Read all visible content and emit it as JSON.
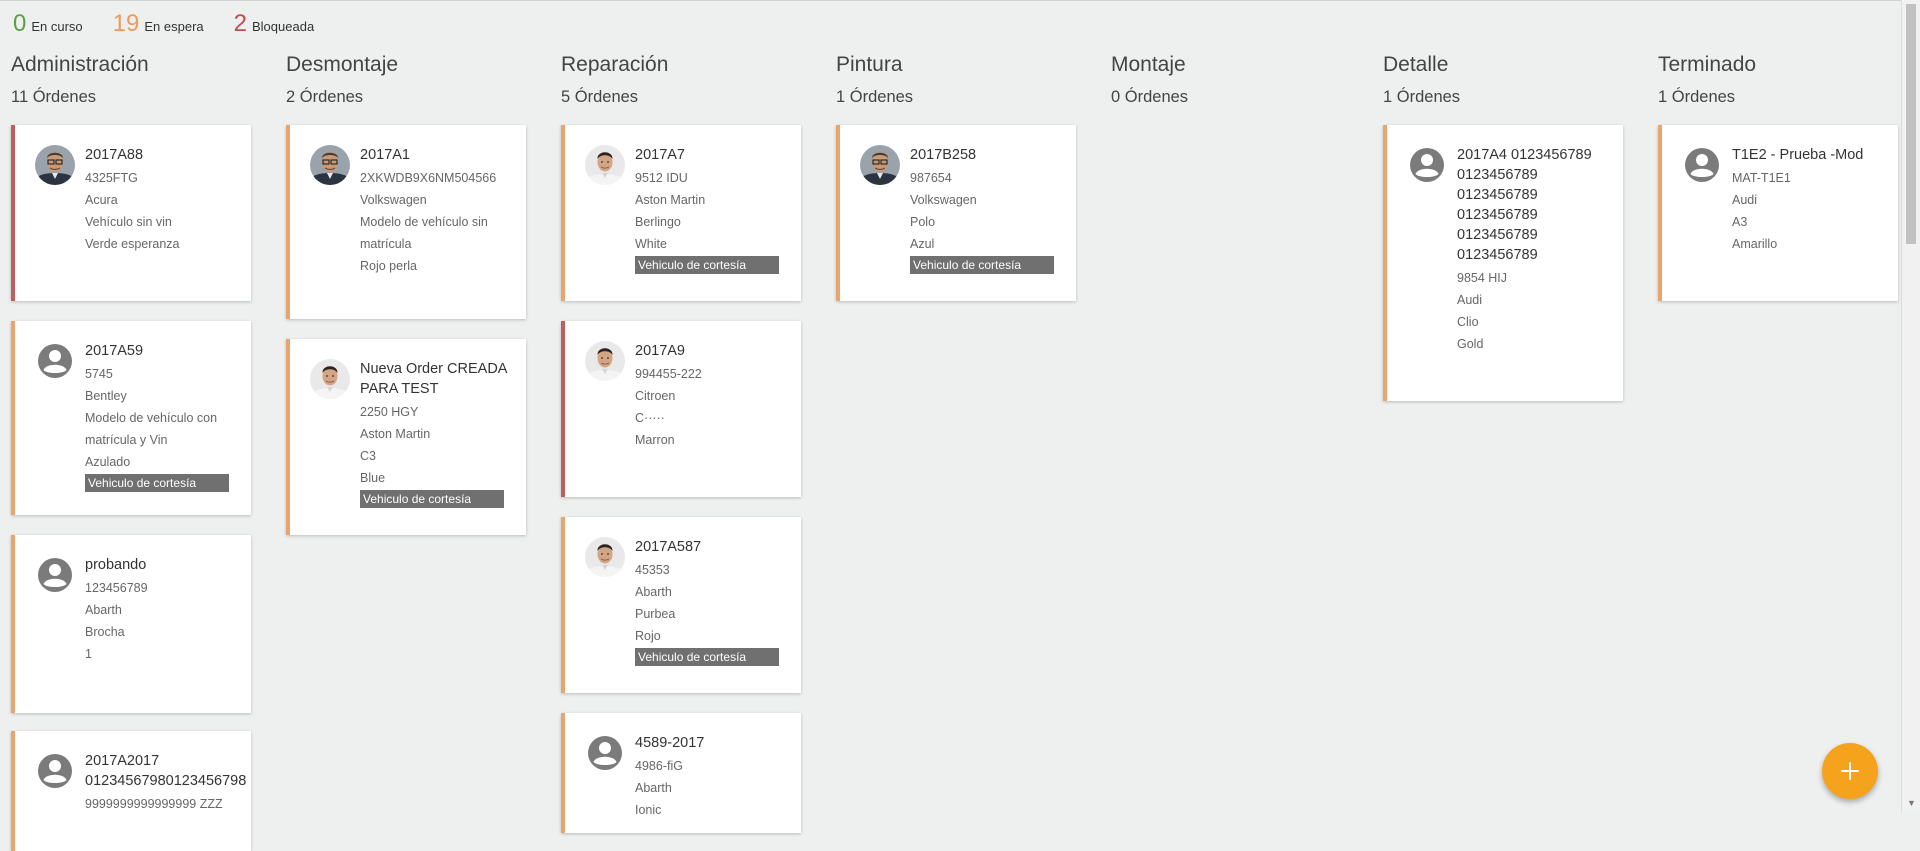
{
  "stats": {
    "in_progress": {
      "count": "0",
      "label": "En curso",
      "color": "#5aa04a"
    },
    "waiting": {
      "count": "19",
      "label": "En espera",
      "color": "#ef9a5a"
    },
    "blocked": {
      "count": "2",
      "label": "Bloqueada",
      "color": "#c0504d"
    }
  },
  "columns": [
    {
      "title": "Administración",
      "count": "11 Órdenes",
      "cards": [
        {
          "avatar": "photo-glasses",
          "accent": "red",
          "title": "2017A88",
          "lines": [
            "4325FTG",
            "Acura",
            "Vehículo sin vin",
            "Verde esperanza"
          ],
          "badge": ""
        },
        {
          "avatar": "placeholder",
          "accent": "orange",
          "title": "2017A59",
          "lines": [
            "5745",
            "Bentley",
            "Modelo de vehículo con matrícula y Vin",
            "Azulado"
          ],
          "badge": "Vehiculo de cortesía"
        },
        {
          "avatar": "placeholder",
          "accent": "orange",
          "title": "probando",
          "lines": [
            "123456789",
            "Abarth",
            "Brocha",
            "1"
          ],
          "badge": ""
        },
        {
          "avatar": "placeholder",
          "accent": "orange",
          "title": "2017A2017 01234567980123456798",
          "lines": [
            "9999999999999999 ZZZ"
          ],
          "badge": ""
        }
      ]
    },
    {
      "title": "Desmontaje",
      "count": "2 Órdenes",
      "cards": [
        {
          "avatar": "photo-glasses",
          "accent": "orange",
          "title": "2017A1",
          "lines": [
            "2XKWDB9X6NM504566",
            "Volkswagen",
            "Modelo de vehículo sin matrícula",
            "Rojo perla"
          ],
          "badge": ""
        },
        {
          "avatar": "photo-man",
          "accent": "orange",
          "title": "Nueva Order CREADA PARA TEST",
          "lines": [
            "2250 HGY",
            "Aston Martin",
            "C3",
            "Blue"
          ],
          "badge": "Vehiculo de cortesía"
        }
      ]
    },
    {
      "title": "Reparación",
      "count": "5 Órdenes",
      "cards": [
        {
          "avatar": "photo-man",
          "accent": "orange",
          "title": "2017A7",
          "lines": [
            "9512 IDU",
            "Aston Martin",
            "Berlingo",
            "White"
          ],
          "badge": "Vehiculo de cortesía"
        },
        {
          "avatar": "photo-man",
          "accent": "red",
          "title": "2017A9",
          "lines": [
            "994455-222",
            "Citroen",
            "C·····",
            "Marron"
          ],
          "badge": ""
        },
        {
          "avatar": "photo-man",
          "accent": "orange",
          "title": "2017A587",
          "lines": [
            "45353",
            "Abarth",
            "Purbea",
            "Rojo"
          ],
          "badge": "Vehiculo de cortesía"
        },
        {
          "avatar": "placeholder",
          "accent": "orange",
          "title": "4589-2017",
          "lines": [
            "4986-fiG",
            "Abarth",
            "Ionic"
          ],
          "badge": ""
        }
      ]
    },
    {
      "title": "Pintura",
      "count": "1 Órdenes",
      "cards": [
        {
          "avatar": "photo-glasses",
          "accent": "orange",
          "title": "2017B258",
          "lines": [
            "987654",
            "Volkswagen",
            "Polo",
            "Azul"
          ],
          "badge": "Vehiculo de cortesía"
        }
      ]
    },
    {
      "title": "Montaje",
      "count": "0 Órdenes",
      "cards": []
    },
    {
      "title": "Detalle",
      "count": "1 Órdenes",
      "cards": [
        {
          "avatar": "placeholder",
          "accent": "orange",
          "title": "2017A4 0123456789 0123456789 0123456789 0123456789 0123456789 0123456789",
          "lines": [
            "9854 HIJ",
            "Audi",
            "Clio",
            "Gold"
          ],
          "badge": ""
        }
      ]
    },
    {
      "title": "Terminado",
      "count": "1 Órdenes",
      "cards": [
        {
          "avatar": "placeholder",
          "accent": "orange",
          "title": "T1E2 - Prueba -Mod",
          "lines": [
            "MAT-T1E1",
            "Audi",
            "A3",
            "Amarillo"
          ],
          "badge": ""
        }
      ]
    }
  ],
  "fab": {
    "icon": "plus-icon"
  }
}
